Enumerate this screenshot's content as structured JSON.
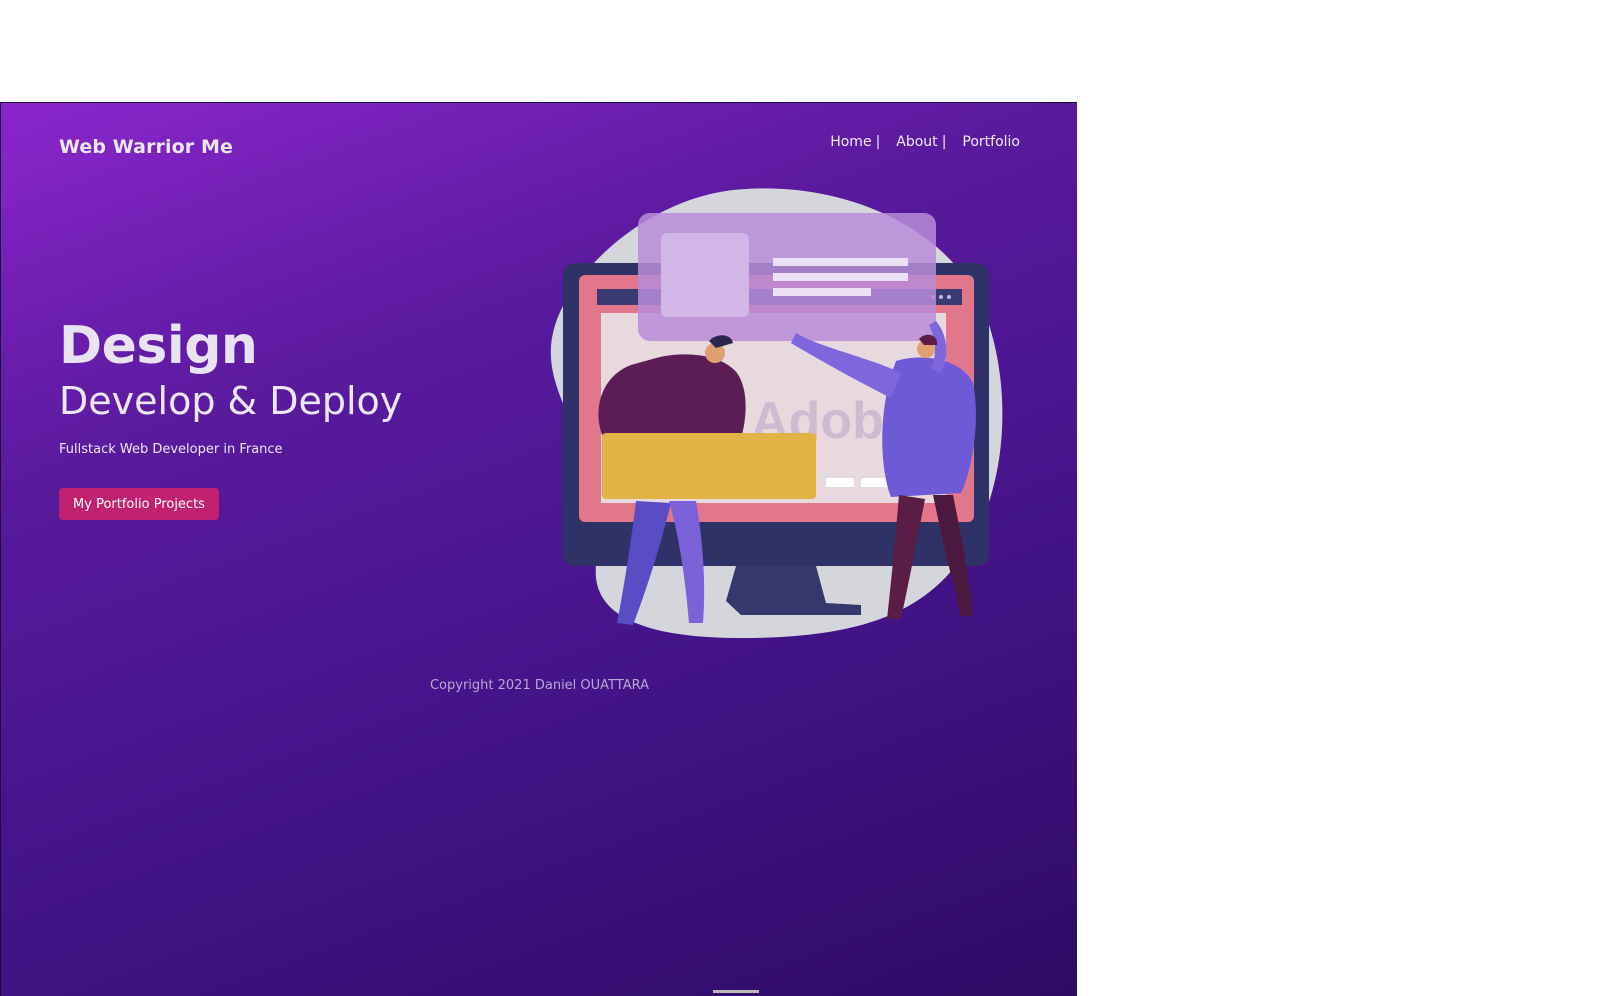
{
  "brand": "Web Warrior Me",
  "nav": {
    "home": "Home",
    "about": "About",
    "portfolio": "Portfolio",
    "separator": "|"
  },
  "hero": {
    "title": "Design",
    "subtitle": "Develop & Deploy",
    "tagline": "Fullstack Web Developer in France",
    "cta_label": "My Portfolio Projects"
  },
  "illustration": {
    "logo_text": "Adobe",
    "icon": "designers-at-monitor-illustration"
  },
  "footer": {
    "copyright": "Copyright 2021 Daniel OUATTARA"
  },
  "colors": {
    "gradient_start": "#8a26cc",
    "gradient_end": "#2e0b66",
    "cta": "#c1216f"
  }
}
